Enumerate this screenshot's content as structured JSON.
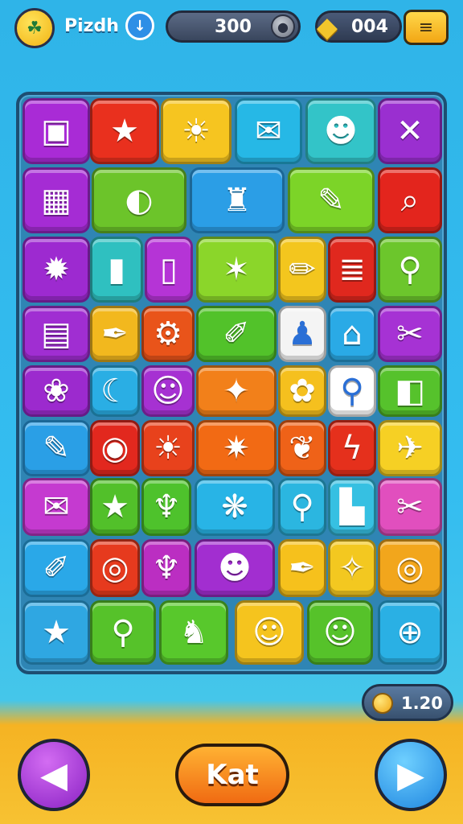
{
  "header": {
    "avatar_icon": "avatar-face-icon",
    "player_name": "Pizdh",
    "score": "300",
    "gems": "004",
    "download_icon": "↓",
    "menu_icon": "≡"
  },
  "board": {
    "tiles": [
      {
        "id": "r1c1",
        "color": "#a92bd6",
        "icon": "▣"
      },
      {
        "id": "r1c2",
        "color": "#e9301e",
        "icon": "★"
      },
      {
        "id": "r1c3",
        "color": "#f6c520",
        "icon": "☀"
      },
      {
        "id": "r1c4",
        "color": "#26b8e6",
        "icon": "✉"
      },
      {
        "id": "r1c5",
        "color": "#33c4c8",
        "icon": "☻"
      },
      {
        "id": "r1c6",
        "color": "#9a2fd0",
        "icon": "✕"
      },
      {
        "id": "r2c1",
        "color": "#a52cd4",
        "icon": "▦"
      },
      {
        "id": "r2c2",
        "color": "#6cc42a",
        "icon": "◐"
      },
      {
        "id": "r2c3",
        "color": "#2b9ee6",
        "icon": "♜"
      },
      {
        "id": "r2c4",
        "color": "#7cd428",
        "icon": "✎"
      },
      {
        "id": "r2c5",
        "color": "#e3251d",
        "icon": "⌕"
      },
      {
        "id": "r3c1",
        "color": "#9d2ad0",
        "icon": "✹"
      },
      {
        "id": "r3c2",
        "color": "#2fc0c0",
        "icon": "▮"
      },
      {
        "id": "r3c3",
        "color": "#b534d6",
        "icon": "▯"
      },
      {
        "id": "r3c4",
        "color": "#8bd62a",
        "icon": "✶"
      },
      {
        "id": "r3c5",
        "color": "#f3c61e",
        "icon": "✏"
      },
      {
        "id": "r3c6",
        "color": "#e0281e",
        "icon": "≣"
      },
      {
        "id": "r3c7",
        "color": "#6cc62c",
        "icon": "⚲"
      },
      {
        "id": "r4c1",
        "color": "#a02ed2",
        "icon": "▤"
      },
      {
        "id": "r4c2",
        "color": "#f2b81e",
        "icon": "✒"
      },
      {
        "id": "r4c3",
        "color": "#e9541a",
        "icon": "⚙"
      },
      {
        "id": "r4c4",
        "color": "#52c22a",
        "icon": "✐"
      },
      {
        "id": "r4c5",
        "color": "#f4f4f4",
        "icon": "♟"
      },
      {
        "id": "r4c6",
        "color": "#2aaae6",
        "icon": "⌂"
      },
      {
        "id": "r4c7",
        "color": "#a632d4",
        "icon": "✂"
      },
      {
        "id": "r5c1",
        "color": "#9c2ace",
        "icon": "❀"
      },
      {
        "id": "r5c2",
        "color": "#2aaee4",
        "icon": "☾"
      },
      {
        "id": "r5c3",
        "color": "#a631d2",
        "icon": "☺"
      },
      {
        "id": "r5c4",
        "color": "#f2801a",
        "icon": "✦"
      },
      {
        "id": "r5c5",
        "color": "#f5c01e",
        "icon": "✿"
      },
      {
        "id": "r5c6",
        "color": "#ffffff",
        "icon": "⚲"
      },
      {
        "id": "r5c7",
        "color": "#56c22c",
        "icon": "◧"
      },
      {
        "id": "r6c1",
        "color": "#2a9fe6",
        "icon": "✎"
      },
      {
        "id": "r6c2",
        "color": "#e2281e",
        "icon": "◉"
      },
      {
        "id": "r6c3",
        "color": "#e8421c",
        "icon": "☀"
      },
      {
        "id": "r6c4",
        "color": "#f26a14",
        "icon": "✷"
      },
      {
        "id": "r6c5",
        "color": "#ef6218",
        "icon": "❦"
      },
      {
        "id": "r6c6",
        "color": "#e5301c",
        "icon": "ϟ"
      },
      {
        "id": "r6c7",
        "color": "#f6d024",
        "icon": "✈"
      },
      {
        "id": "r7c1",
        "color": "#c53ad0",
        "icon": "✉"
      },
      {
        "id": "r7c2",
        "color": "#52c02a",
        "icon": "★"
      },
      {
        "id": "r7c3",
        "color": "#4ec22c",
        "icon": "♆"
      },
      {
        "id": "r7c4",
        "color": "#28b4e6",
        "icon": "❋"
      },
      {
        "id": "r7c5",
        "color": "#2bb6e0",
        "icon": "⚲"
      },
      {
        "id": "r7c6",
        "color": "#36c0e2",
        "icon": "▙"
      },
      {
        "id": "r7c7",
        "color": "#e14fbe",
        "icon": "✂"
      },
      {
        "id": "r8c1",
        "color": "#2aa8e8",
        "icon": "✐"
      },
      {
        "id": "r8c2",
        "color": "#e63a1e",
        "icon": "◎"
      },
      {
        "id": "r8c3",
        "color": "#bb2ec2",
        "icon": "♆"
      },
      {
        "id": "r8c4",
        "color": "#a22ed0",
        "icon": "☻"
      },
      {
        "id": "r8c5",
        "color": "#f6c11c",
        "icon": "✒"
      },
      {
        "id": "r8c6",
        "color": "#f3c820",
        "icon": "✧"
      },
      {
        "id": "r8c7",
        "color": "#f2a61c",
        "icon": "◎"
      },
      {
        "id": "r9c1",
        "color": "#2fa7e2",
        "icon": "★"
      },
      {
        "id": "r9c2",
        "color": "#56c22a",
        "icon": "⚲"
      },
      {
        "id": "r9c3",
        "color": "#58c82c",
        "icon": "♞"
      },
      {
        "id": "r9c4",
        "color": "#f5c41e",
        "icon": "☺"
      },
      {
        "id": "r9c5",
        "color": "#56c22a",
        "icon": "☺"
      },
      {
        "id": "r9c6",
        "color": "#2ab0e4",
        "icon": "⊕"
      }
    ]
  },
  "coins": "1.20",
  "footer": {
    "prev_icon": "◀",
    "center_label": "Kat",
    "next_icon": "▶"
  }
}
